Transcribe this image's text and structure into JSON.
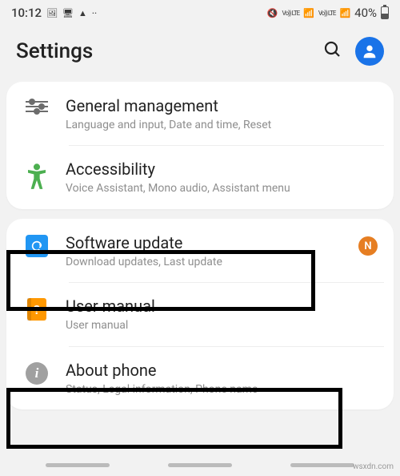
{
  "status": {
    "time": "10:12",
    "lte1": "LTE1",
    "lte2": "LTE2",
    "battery_pct": "40%"
  },
  "header": {
    "title": "Settings"
  },
  "groups": [
    {
      "items": [
        {
          "title": "General management",
          "sub": "Language and input, Date and time, Reset"
        },
        {
          "title": "Accessibility",
          "sub": "Voice Assistant, Mono audio, Assistant menu"
        }
      ]
    },
    {
      "items": [
        {
          "title": "Software update",
          "sub": "Download updates, Last update",
          "badge": "N"
        },
        {
          "title": "User manual",
          "sub": "User manual"
        },
        {
          "title": "About phone",
          "sub": "Status, Legal information, Phone name"
        }
      ]
    }
  ],
  "watermark": "wsxdn.com"
}
